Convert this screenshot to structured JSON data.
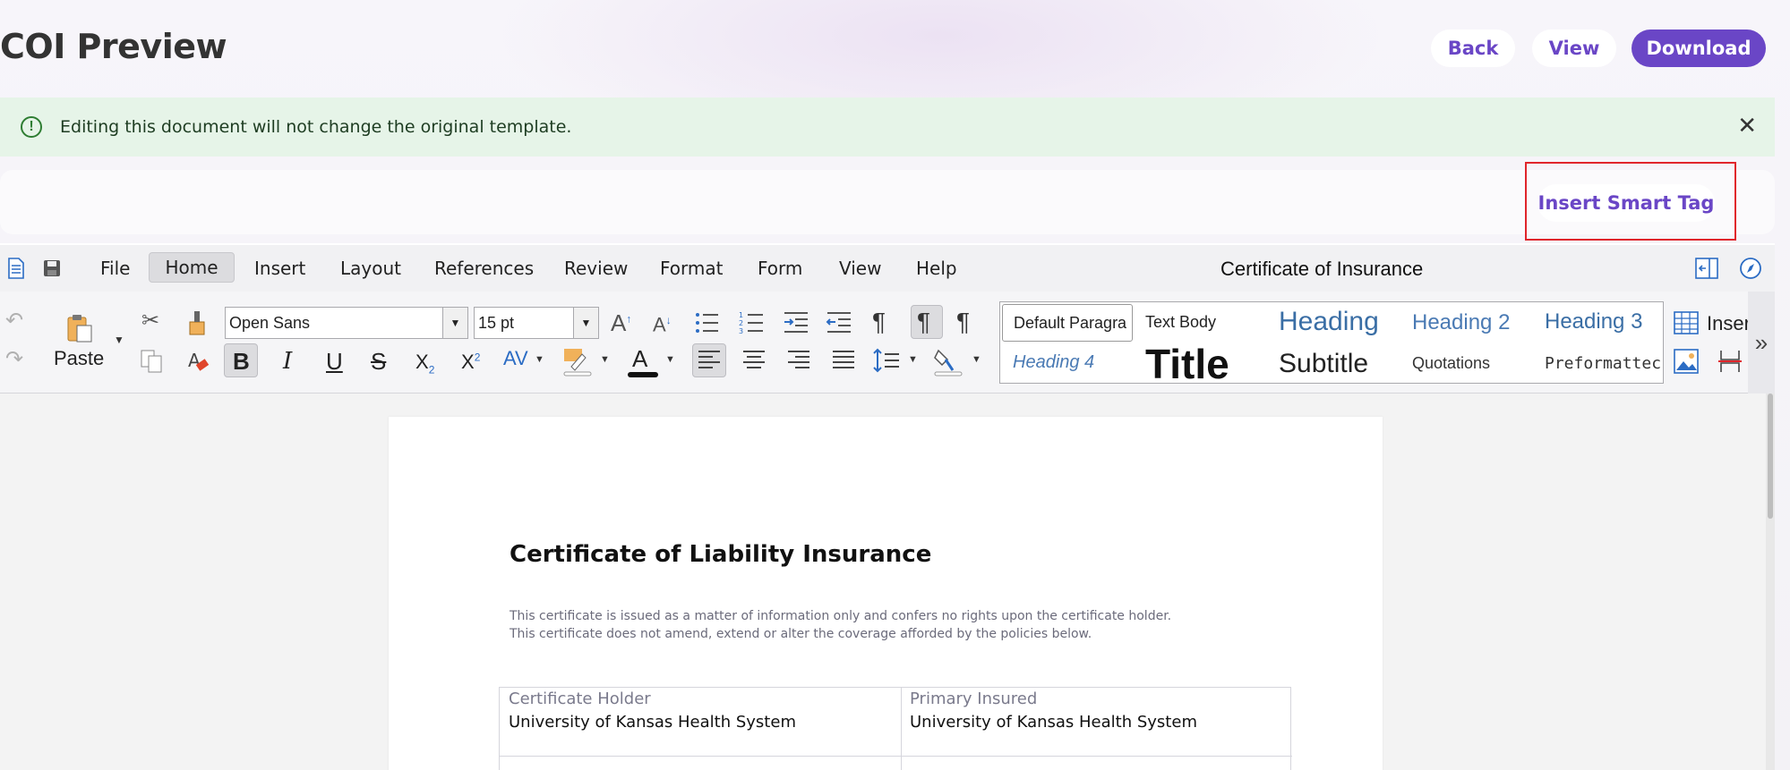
{
  "header": {
    "title": "COI Preview",
    "buttons": {
      "back": "Back",
      "view": "View",
      "download": "Download"
    }
  },
  "banner": {
    "message": "Editing this document will not change the original template.",
    "info_glyph": "!",
    "close_glyph": "✕"
  },
  "smart_tag": {
    "label": "Insert Smart Tag"
  },
  "menu": {
    "items": [
      "File",
      "Home",
      "Insert",
      "Layout",
      "References",
      "Review",
      "Format",
      "Form",
      "View",
      "Help"
    ],
    "document_title": "Certificate of Insurance"
  },
  "ribbon": {
    "paste_label": "Paste",
    "font_family": "Open Sans",
    "font_size": "15 pt",
    "insert_label": "Inser",
    "styles": {
      "default_paragraph": "Default Paragra",
      "text_body": "Text Body",
      "heading1": "Heading",
      "heading2": "Heading 2",
      "heading3": "Heading 3",
      "heading4": "Heading 4",
      "title": "Title",
      "subtitle": "Subtitle",
      "quotations": "Quotations",
      "preformatted": "Preformattec"
    },
    "more_glyph": "»"
  },
  "document": {
    "heading": "Certificate of Liability Insurance",
    "disclaimer_line1": "This certificate is issued as a matter of information only and confers no rights upon the certificate holder.",
    "disclaimer_line2": "This certificate does not amend, extend or alter the coverage afforded by the policies below.",
    "table": {
      "certificate_holder_label": "Certificate Holder",
      "certificate_holder_value": "University of Kansas Health System",
      "primary_insured_label": "Primary Insured",
      "primary_insured_value": "University of Kansas Health System"
    }
  },
  "colors": {
    "accent": "#6a46c6",
    "banner_bg": "#e6f4e8",
    "banner_icon": "#2e7d32",
    "highlight_box": "#e0252b"
  }
}
